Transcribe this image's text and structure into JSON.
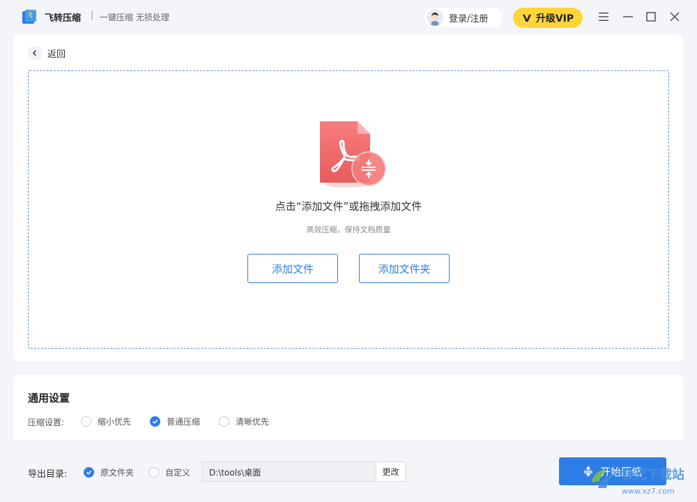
{
  "app": {
    "name": "飞转压缩",
    "separator": "|",
    "slogan": "一键压缩 无损处理",
    "login_label": "登录/注册",
    "vip_label": "升级VIP",
    "accent_color": "#2e7ce6",
    "vip_color": "#ffd53a"
  },
  "window_controls": {
    "menu_icon": "hamburger-icon",
    "minimize_icon": "minimize-icon",
    "maximize_icon": "maximize-icon",
    "close_icon": "close-icon"
  },
  "upload": {
    "back_label": "返回",
    "title": "点击“添加文件”或拖拽添加文件",
    "subtitle": "高效压缩，保持文档质量",
    "add_file_label": "添加文件",
    "add_folder_label": "添加文件夹",
    "file_icon": "pdf-compress-icon"
  },
  "settings": {
    "title": "通用设置",
    "compression_label": "压缩设置:",
    "options": [
      {
        "label": "缩小优先",
        "checked": false
      },
      {
        "label": "普通压缩",
        "checked": true
      },
      {
        "label": "清晰优先",
        "checked": false
      }
    ]
  },
  "output": {
    "label": "导出目录:",
    "options": [
      {
        "label": "原文件夹",
        "checked": true
      },
      {
        "label": "自定义",
        "checked": false
      }
    ],
    "path": "D:\\tools\\桌面",
    "change_label": "更改"
  },
  "start_label": "开始压缩",
  "watermark": {
    "text1": "极光下载站",
    "text2": "www.xz7.com"
  }
}
